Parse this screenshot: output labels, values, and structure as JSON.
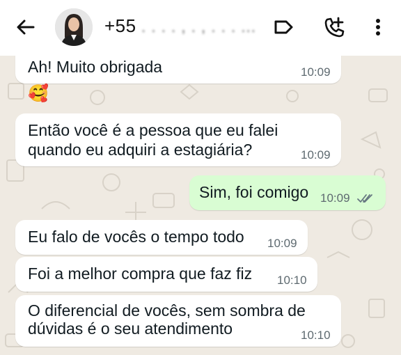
{
  "header": {
    "contact_prefix": "+55",
    "contact_masked": " . . . . , . , . . . ...",
    "icons": [
      "back-arrow-icon",
      "label-tag-icon",
      "add-call-icon",
      "more-vert-icon"
    ]
  },
  "messages": [
    {
      "text": "Ah! Muito obrigada",
      "time": "10:09",
      "direction": "in"
    },
    {
      "text": "🥰",
      "time": "",
      "direction": "in"
    },
    {
      "lines": [
        "Então você é a pessoa que eu falei",
        "quando eu adquiri a estagiária?"
      ],
      "time": "10:09",
      "direction": "in"
    },
    {
      "text": "Sim, foi comigo",
      "time": "10:09",
      "direction": "out",
      "status": "read"
    },
    {
      "text": "Eu falo de vocês o tempo todo",
      "time": "10:09",
      "direction": "in"
    },
    {
      "text": "Foi a melhor compra que faz fiz",
      "time": "10:10",
      "direction": "in"
    },
    {
      "lines": [
        "O diferencial de vocês, sem sombra de",
        "dúvidas é o seu atendimento"
      ],
      "time": "10:10",
      "direction": "in"
    }
  ],
  "colors": {
    "incoming": "#ffffff",
    "outgoing": "#d9fdd3",
    "read_ticks": "#53bdeb",
    "wallpaper": "#efeae2"
  }
}
